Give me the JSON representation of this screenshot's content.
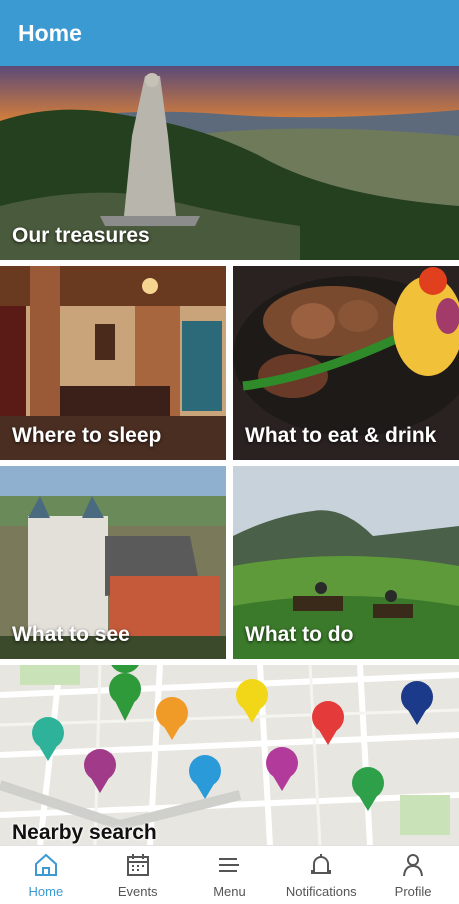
{
  "app_bar": {
    "title": "Home"
  },
  "tiles": [
    {
      "label": "Our treasures"
    },
    {
      "label": "Where to sleep"
    },
    {
      "label": "What to eat & drink"
    },
    {
      "label": "What to see"
    },
    {
      "label": "What to do"
    },
    {
      "label": "Nearby search"
    }
  ],
  "bottom_nav": {
    "items": [
      {
        "label": "Home",
        "icon": "home-icon",
        "active": true
      },
      {
        "label": "Events",
        "icon": "calendar-icon",
        "active": false
      },
      {
        "label": "Menu",
        "icon": "menu-icon",
        "active": false
      },
      {
        "label": "Notifications",
        "icon": "bell-icon",
        "active": false
      },
      {
        "label": "Profile",
        "icon": "person-icon",
        "active": false
      }
    ]
  },
  "colors": {
    "accent": "#3c9ad3",
    "nav_inactive": "#555555"
  }
}
